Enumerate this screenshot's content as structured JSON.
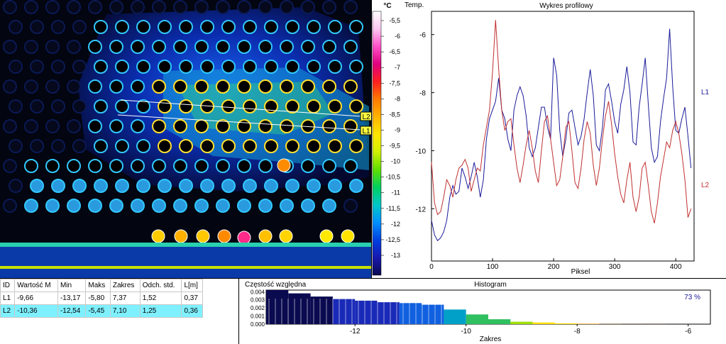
{
  "thermogram": {
    "line_labels": [
      "L2",
      "L1"
    ]
  },
  "colorscale": {
    "unit": "°C",
    "ticks": [
      "-5,5",
      "-6",
      "-6,5",
      "-7",
      "-7,5",
      "-8",
      "-8,5",
      "-9",
      "-9,5",
      "-10",
      "-10,5",
      "-11",
      "-11,5",
      "-12",
      "-12,5",
      "-13"
    ],
    "colors": [
      "#ffffff",
      "#ffc8f0",
      "#ff50c8",
      "#e0007e",
      "#ff2020",
      "#ff7a00",
      "#ffb400",
      "#ffe600",
      "#d0f000",
      "#60e000",
      "#00d060",
      "#00c8c8",
      "#0090ff",
      "#0040e0",
      "#1818b0",
      "#0a0a50"
    ]
  },
  "chart_data": [
    {
      "type": "line",
      "title": "Wykres profilowy",
      "xlabel": "Piksel",
      "ylabel": "Temp.",
      "xlim": [
        0,
        430
      ],
      "ylim": [
        -13.8,
        -5.2
      ],
      "xticks": [
        0,
        100,
        200,
        300,
        400
      ],
      "yticks": [
        -12,
        -10,
        -8,
        -6
      ],
      "series": [
        {
          "name": "L1",
          "color": "#1a1a9a",
          "x": [
            0,
            5,
            10,
            15,
            20,
            25,
            30,
            35,
            40,
            45,
            50,
            55,
            60,
            65,
            70,
            75,
            80,
            85,
            90,
            95,
            100,
            105,
            110,
            115,
            120,
            125,
            130,
            135,
            140,
            145,
            150,
            155,
            160,
            165,
            170,
            175,
            180,
            185,
            190,
            195,
            200,
            205,
            210,
            215,
            220,
            225,
            230,
            235,
            240,
            245,
            250,
            255,
            260,
            265,
            270,
            275,
            280,
            285,
            290,
            295,
            300,
            305,
            310,
            315,
            320,
            325,
            330,
            335,
            340,
            345,
            350,
            355,
            360,
            365,
            370,
            375,
            380,
            385,
            390,
            395,
            400,
            405,
            410,
            415,
            420,
            425
          ],
          "values": [
            -12.4,
            -12.9,
            -13.1,
            -13.0,
            -12.8,
            -12.4,
            -11.6,
            -11.2,
            -11.5,
            -11.4,
            -10.6,
            -10.9,
            -11.3,
            -10.9,
            -10.4,
            -10.9,
            -11.6,
            -11.0,
            -9.6,
            -8.9,
            -8.6,
            -8.3,
            -7.5,
            -8.6,
            -8.9,
            -9.6,
            -10.0,
            -8.6,
            -8.1,
            -7.8,
            -8.1,
            -8.8,
            -9.9,
            -10.2,
            -9.9,
            -9.2,
            -8.5,
            -8.5,
            -9.2,
            -9.6,
            -6.8,
            -7.4,
            -9.3,
            -10.2,
            -9.6,
            -8.7,
            -8.6,
            -9.2,
            -9.8,
            -9.5,
            -8.9,
            -8.0,
            -7.2,
            -8.1,
            -9.8,
            -10.0,
            -9.2,
            -7.9,
            -7.7,
            -8.3,
            -9.0,
            -9.4,
            -8.4,
            -7.9,
            -7.1,
            -8.0,
            -9.7,
            -9.8,
            -8.5,
            -7.7,
            -6.8,
            -8.4,
            -9.9,
            -10.4,
            -10.2,
            -9.0,
            -8.2,
            -7.5,
            -5.8,
            -7.8,
            -9.3,
            -9.4,
            -8.9,
            -8.5,
            -9.5,
            -10.6
          ]
        },
        {
          "name": "L2",
          "color": "#c03030",
          "x": [
            0,
            5,
            10,
            15,
            20,
            25,
            30,
            35,
            40,
            45,
            50,
            55,
            60,
            65,
            70,
            75,
            80,
            85,
            90,
            95,
            100,
            105,
            110,
            115,
            120,
            125,
            130,
            135,
            140,
            145,
            150,
            155,
            160,
            165,
            170,
            175,
            180,
            185,
            190,
            195,
            200,
            205,
            210,
            215,
            220,
            225,
            230,
            235,
            240,
            245,
            250,
            255,
            260,
            265,
            270,
            275,
            280,
            285,
            290,
            295,
            300,
            305,
            310,
            315,
            320,
            325,
            330,
            335,
            340,
            345,
            350,
            355,
            360,
            365,
            370,
            375,
            380,
            385,
            390,
            395,
            400,
            405,
            410,
            415,
            420,
            425
          ],
          "values": [
            -10.4,
            -11.8,
            -12.2,
            -12.1,
            -11.6,
            -11.0,
            -11.2,
            -11.6,
            -11.0,
            -10.6,
            -10.5,
            -10.3,
            -10.6,
            -11.4,
            -11.0,
            -10.6,
            -10.7,
            -9.8,
            -9.2,
            -8.6,
            -7.3,
            -5.5,
            -7.2,
            -8.6,
            -9.3,
            -9.0,
            -8.9,
            -9.8,
            -10.6,
            -11.1,
            -10.5,
            -9.8,
            -9.3,
            -9.9,
            -10.7,
            -11.1,
            -10.0,
            -9.0,
            -8.8,
            -9.6,
            -10.4,
            -11.2,
            -11.0,
            -10.2,
            -9.2,
            -9.0,
            -10.0,
            -11.1,
            -11.3,
            -10.6,
            -9.6,
            -9.0,
            -9.4,
            -10.5,
            -11.2,
            -10.6,
            -9.6,
            -8.8,
            -8.3,
            -9.1,
            -10.1,
            -10.9,
            -11.5,
            -11.8,
            -11.0,
            -10.4,
            -11.6,
            -12.1,
            -11.6,
            -10.6,
            -10.4,
            -11.2,
            -12.1,
            -12.5,
            -11.8,
            -10.9,
            -10.3,
            -9.7,
            -9.9,
            -9.3,
            -9.0,
            -9.4,
            -10.1,
            -11.0,
            -12.3,
            -12.0
          ]
        }
      ]
    },
    {
      "type": "area",
      "title": "Histogram",
      "ylabel": "Częstość względna",
      "xlabel": "Zakres",
      "xlim": [
        -13.6,
        -5.6
      ],
      "ylim": [
        0,
        0.0042
      ],
      "xticks": [
        -12,
        -10,
        -8,
        -6
      ],
      "yticks": [
        0.0,
        0.001,
        0.002,
        0.003,
        0.004
      ],
      "ytick_labels": [
        "0.000",
        "0.001",
        "0.002",
        "0.003",
        "0.004"
      ],
      "percent_label": "73 %",
      "x": [
        -13.6,
        -13.2,
        -12.8,
        -12.4,
        -12.0,
        -11.6,
        -11.2,
        -10.8,
        -10.4,
        -10.0,
        -9.6,
        -9.2,
        -8.8,
        -8.4,
        -8.0,
        -7.6,
        -7.2,
        -6.8,
        -6.4,
        -6.0,
        -5.6
      ],
      "values": [
        0.0042,
        0.0038,
        0.0034,
        0.0031,
        0.0029,
        0.0027,
        0.0026,
        0.0024,
        0.0018,
        0.0012,
        0.0006,
        0.0003,
        0.0002,
        0.0001,
        5e-05,
        2e-05,
        1e-05,
        1e-05,
        0.0,
        0.0,
        0.0
      ]
    }
  ],
  "stats_table": {
    "headers": [
      "ID",
      "Wartość M",
      "Min",
      "Maks",
      "Zakres",
      "Odch. std.",
      "L[m]"
    ],
    "rows": [
      [
        "L1",
        "-9,66",
        "-13,17",
        "-5,80",
        "7,37",
        "1,52",
        "0,37"
      ],
      [
        "L2",
        "-10,36",
        "-12,54",
        "-5,45",
        "7,10",
        "1,25",
        "0,36"
      ]
    ]
  }
}
